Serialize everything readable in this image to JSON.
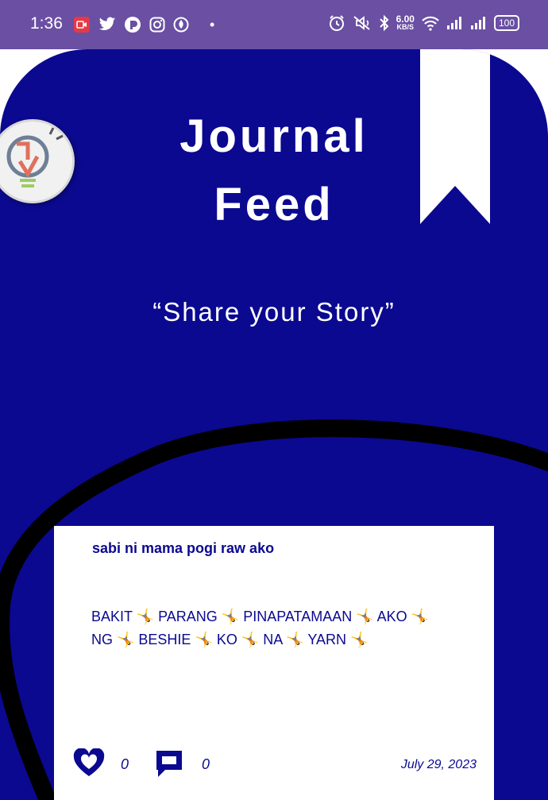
{
  "status_bar": {
    "time": "1:36",
    "dot": "•",
    "speed_value": "6.00",
    "speed_unit": "KB/S",
    "battery": "100",
    "left_icons": [
      "recording-icon",
      "twitter-icon",
      "app-icon",
      "instagram-icon",
      "app-icon-2"
    ],
    "right_icons": [
      "alarm-icon",
      "mute-icon",
      "bluetooth-icon",
      "wifi-icon",
      "signal-icon",
      "signal-icon-2"
    ]
  },
  "header": {
    "title_line1": "Journal",
    "title_line2": "Feed",
    "tagline": "“Share your Story”"
  },
  "post": {
    "title": "sabi ni mama pogi raw ako",
    "body": "BAKIT 🤸 PARANG 🤸 PINAPATAMAAN 🤸 AKO 🤸 NG 🤸 BESHIE 🤸 KO 🤸 NA 🤸 YARN 🤸",
    "likes": "0",
    "comments": "0",
    "date": "July 29, 2023"
  },
  "colors": {
    "status_bar": "#6a4fa3",
    "panel": "#0b0990",
    "accent": "#0b0990",
    "card": "#ffffff"
  }
}
